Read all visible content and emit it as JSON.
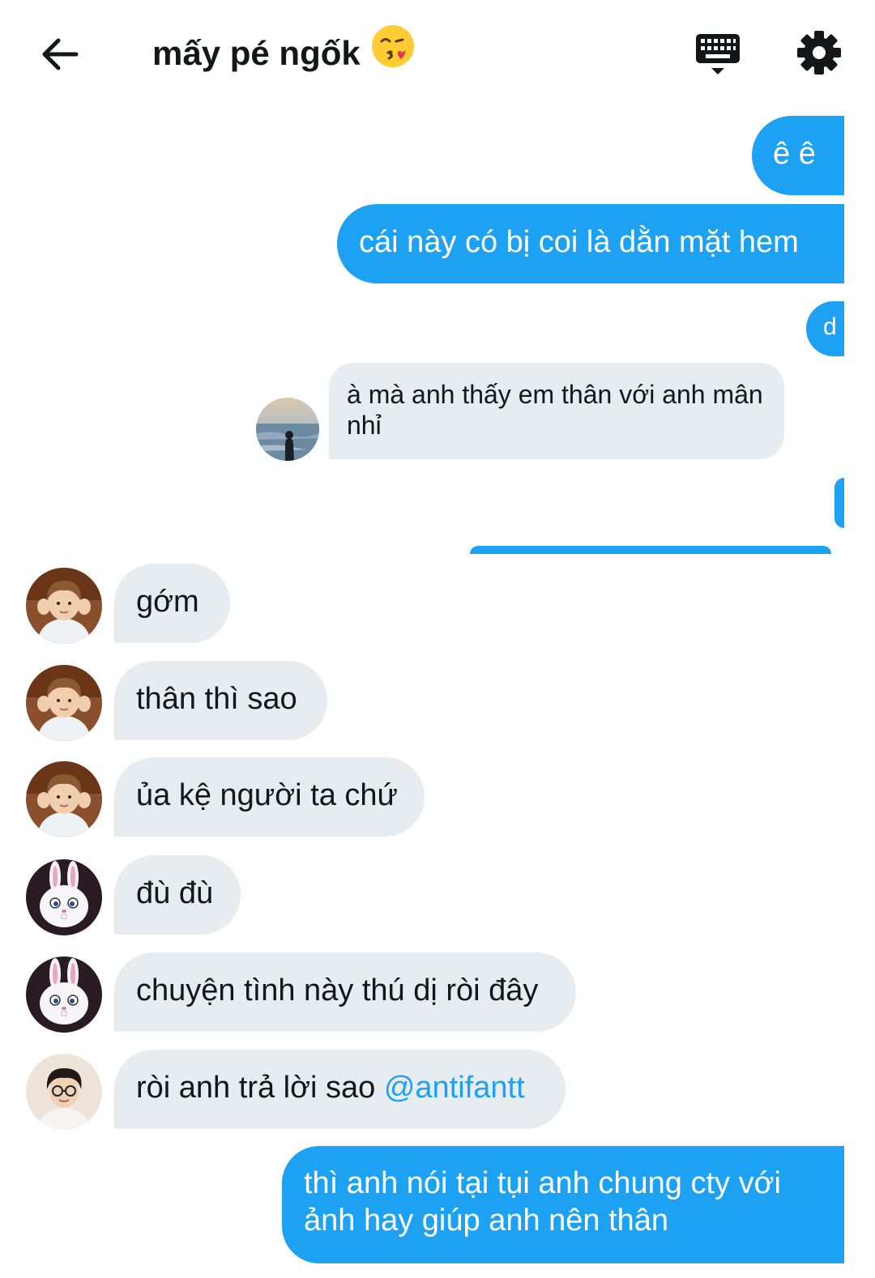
{
  "header": {
    "title": "mấy pé ngốk",
    "title_emoji": "kissing-face-emoji",
    "back_icon": "arrow-left-icon",
    "keyboard_icon": "keyboard-icon",
    "settings_icon": "gear-icon"
  },
  "colors": {
    "accent": "#1da1f2",
    "incoming_bubble": "#e6ecf0",
    "text": "#14171a"
  },
  "messages": [
    {
      "direction": "out",
      "text": "ê ê"
    },
    {
      "direction": "out",
      "text": "cái này có bị coi là dằn mặt hem"
    },
    {
      "direction": "out",
      "text": "d"
    },
    {
      "direction": "in",
      "avatar": "seaside-silhouette",
      "text": "à mà anh thấy em thân với anh mân nhỉ"
    },
    {
      "direction": "out",
      "text": ""
    },
    {
      "direction": "in",
      "avatar": "boy-hands-on-cheeks",
      "text": "gớm"
    },
    {
      "direction": "in",
      "avatar": "boy-hands-on-cheeks",
      "text": "thân thì sao"
    },
    {
      "direction": "in",
      "avatar": "boy-hands-on-cheeks",
      "text": "ủa kệ người ta chứ"
    },
    {
      "direction": "in",
      "avatar": "white-bunny",
      "text": "đù đù"
    },
    {
      "direction": "in",
      "avatar": "white-bunny",
      "text": "chuyện tình này thú dị ròi đây"
    },
    {
      "direction": "in",
      "avatar": "boy-with-glasses",
      "text": "ròi anh trả lời sao ",
      "mention": "@antifantt"
    },
    {
      "direction": "out",
      "text": "thì anh nói tại tụi anh chung cty với ảnh hay giúp anh nên thân"
    }
  ]
}
